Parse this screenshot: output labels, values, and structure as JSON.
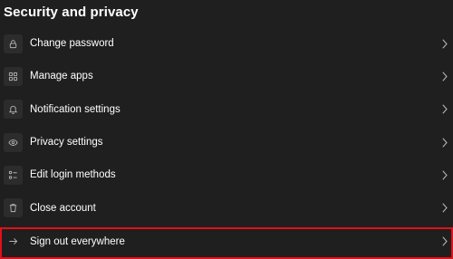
{
  "section": {
    "title": "Security and privacy"
  },
  "items": [
    {
      "label": "Change password",
      "icon": "lock-icon"
    },
    {
      "label": "Manage apps",
      "icon": "apps-grid-icon"
    },
    {
      "label": "Notification settings",
      "icon": "bell-icon"
    },
    {
      "label": "Privacy settings",
      "icon": "eye-icon"
    },
    {
      "label": "Edit login methods",
      "icon": "login-methods-icon"
    },
    {
      "label": "Close account",
      "icon": "trash-icon"
    },
    {
      "label": "Sign out everywhere",
      "icon": "arrow-right-icon"
    }
  ],
  "colors": {
    "background": "#1f1f1f",
    "icon_tile": "#2c2c2c",
    "icon_stroke": "#b3b3b3",
    "highlight_border": "#e0101a"
  }
}
